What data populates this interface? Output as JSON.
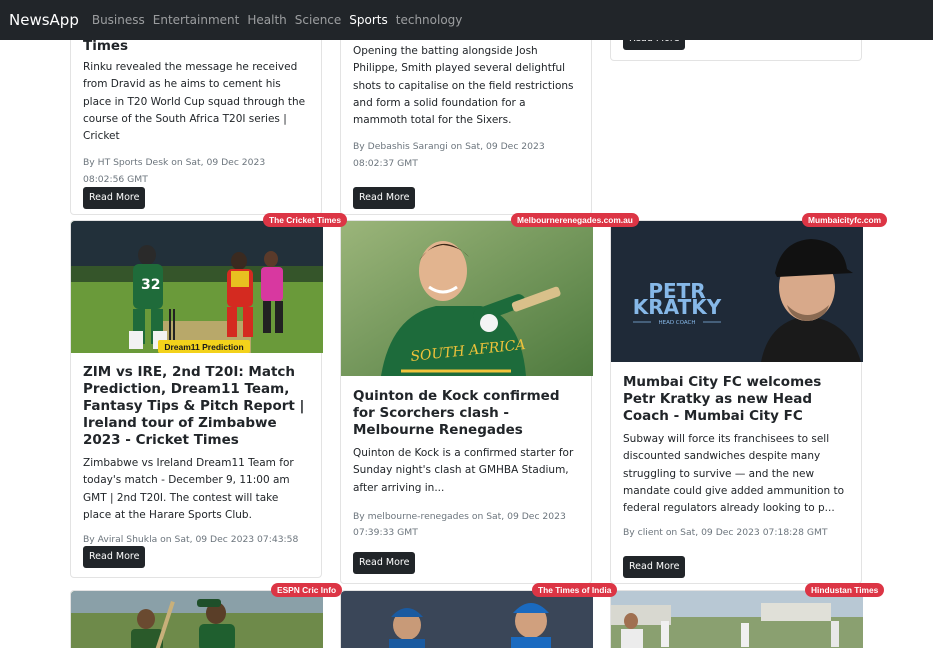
{
  "nav": {
    "brand": "NewsApp",
    "links": [
      "Business",
      "Entertainment",
      "Health",
      "Science",
      "Sports",
      "technology"
    ],
    "active": "Sports"
  },
  "read_more": "Read More",
  "row0": [
    {
      "title_tail": "Times",
      "desc": "Rinku revealed the message he received from Dravid as he aims to cement his place in T20 World Cup squad through the course of the South Africa T20I series | Cricket",
      "byline": "By HT Sports Desk on Sat, 09 Dec 2023 08:02:56 GMT"
    },
    {
      "desc": "Opening the batting alongside Josh Philippe, Smith played several delightful shots to capitalise on the field restrictions and form a solid foundation for a mammoth total for the Sixers.",
      "byline": "By Debashis Sarangi on Sat, 09 Dec 2023 08:02:37 GMT"
    },
    {}
  ],
  "row1": [
    {
      "source": "The Cricket Times",
      "image_caption": "Dream11 Prediction",
      "title": "ZIM vs IRE, 2nd T20I: Match Prediction, Dream11 Team, Fantasy Tips & Pitch Report | Ireland tour of Zimbabwe 2023 - Cricket Times",
      "desc": "Zimbabwe vs Ireland Dream11 Team for today's match - December 9, 11:00 am GMT | 2nd T20I. The contest will take place at the Harare Sports Club.",
      "byline": "By Aviral Shukla on Sat, 09 Dec 2023 07:43:58 GMT"
    },
    {
      "source": "Melbournerenegades.com.au",
      "image_caption": "SOUTH AFRICA",
      "title": "Quinton de Kock confirmed for Scorchers clash - Melbourne Renegades",
      "desc": "Quinton de Kock is a confirmed starter for Sunday night's clash at GMHBA Stadium, after arriving in...",
      "byline": "By melbourne-renegades on Sat, 09 Dec 2023 07:39:33 GMT"
    },
    {
      "source": "Mumbaicityfc.com",
      "image_text": [
        "PETR",
        "KRATKY",
        "HEAD COACH"
      ],
      "title": "Mumbai City FC welcomes Petr Kratky as new Head Coach - Mumbai City FC",
      "desc": "Subway will force its franchisees to sell discounted sandwiches despite many struggling to survive — and the new mandate could give added ammunition to federal regulators already looking to p...",
      "byline": "By client on Sat, 09 Dec 2023 07:18:28 GMT"
    }
  ],
  "row2": [
    {
      "source": "ESPN Cric Info"
    },
    {
      "source": "The Times of India"
    },
    {
      "source": "Hindustan Times"
    }
  ]
}
